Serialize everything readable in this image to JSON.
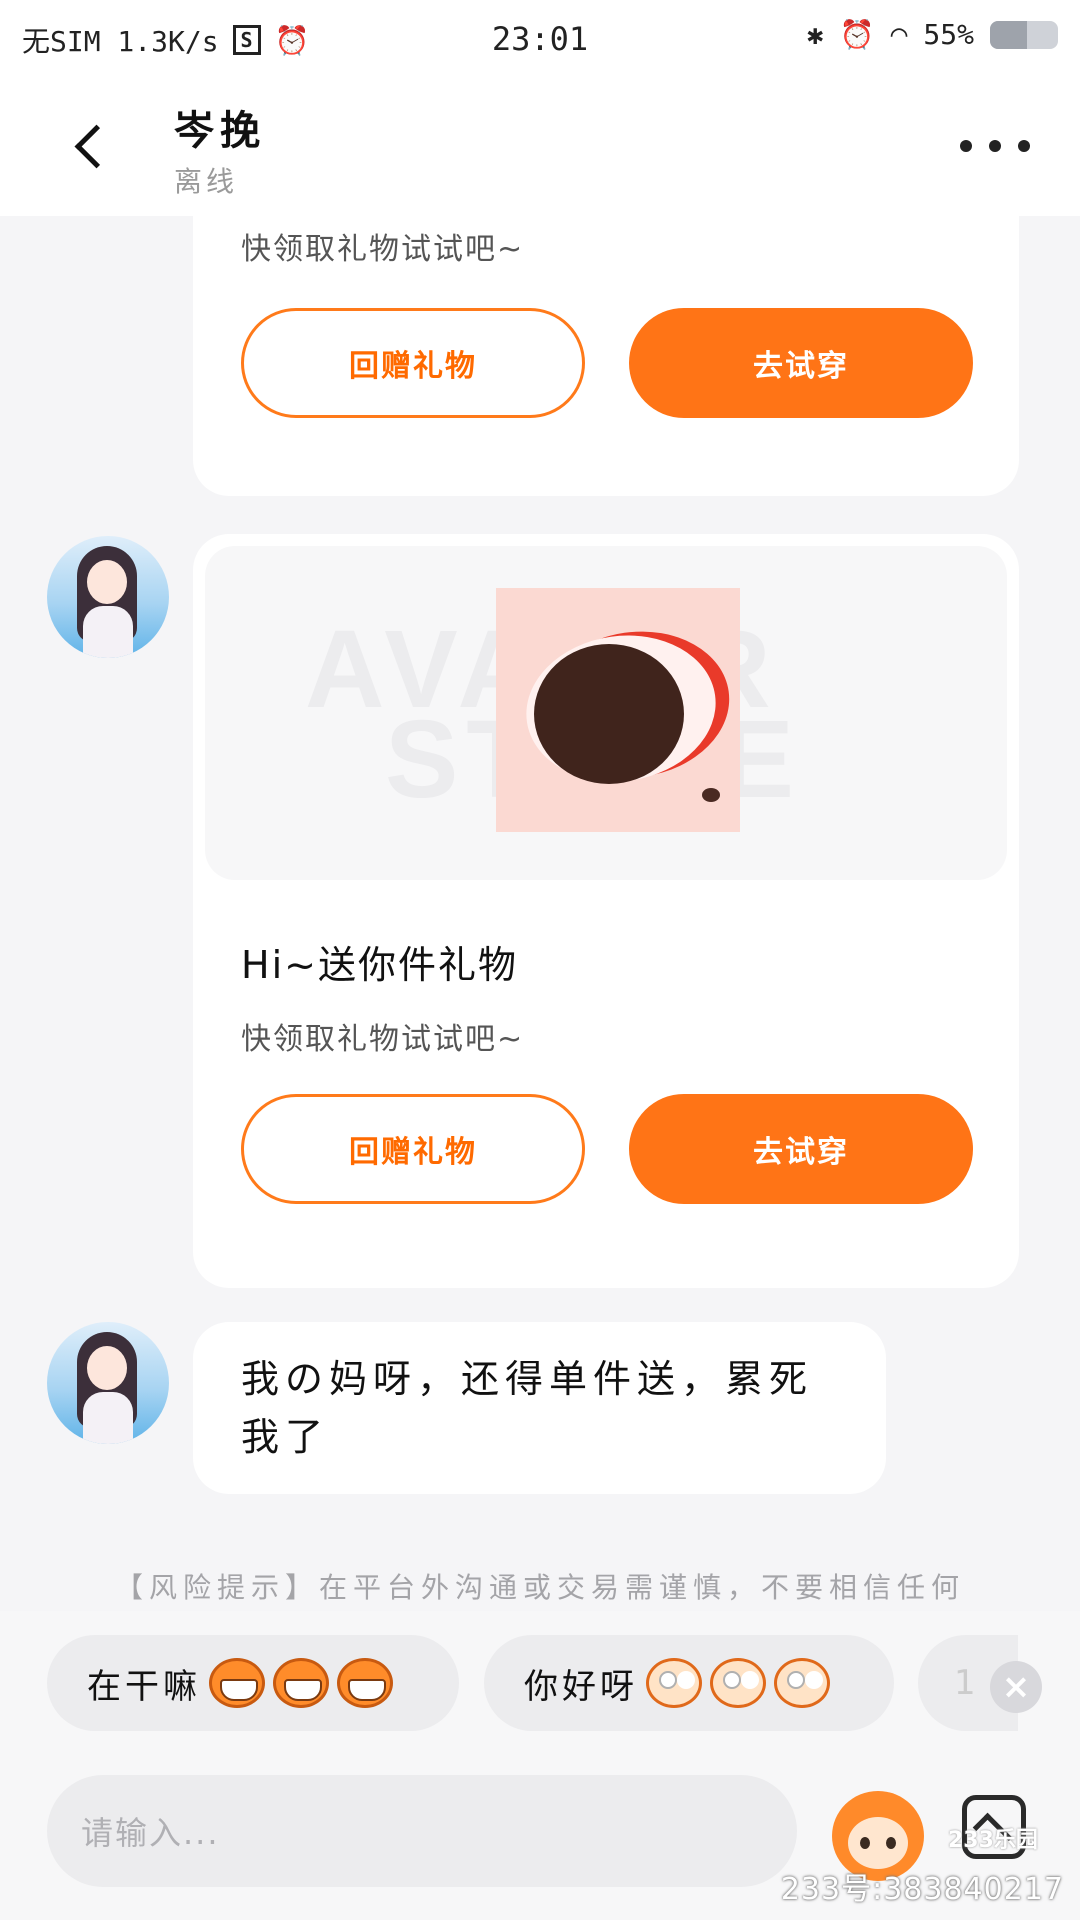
{
  "status_bar": {
    "left": "无SIM 1.3K/s",
    "sim_icon": "S",
    "time": "23:01",
    "battery": "55%",
    "battery_level": 0.55
  },
  "header": {
    "title": "岑挽",
    "subtitle": "离线"
  },
  "messages": [
    {
      "type": "gift",
      "subtitle": "快领取礼物试试吧~",
      "btn_outline": "回赠礼物",
      "btn_solid": "去试穿"
    },
    {
      "type": "gift",
      "preview_watermark_1": "AVATAR",
      "preview_watermark_2": "STORE",
      "title": "Hi~送你件礼物",
      "subtitle": "快领取礼物试试吧~",
      "btn_outline": "回赠礼物",
      "btn_solid": "去试穿"
    },
    {
      "type": "text",
      "text": "我の妈呀，还得单件送，累死我了"
    }
  ],
  "risk_tip": "【风险提示】在平台外沟通或交易需谨慎，不要相信任何",
  "quick_replies": [
    {
      "label": "在干嘛",
      "emoji": "grin-mascot-icon"
    },
    {
      "label": "你好呀",
      "emoji": "blush-mascot-icon"
    },
    {
      "label": "1"
    }
  ],
  "input": {
    "placeholder": "请输入..."
  },
  "watermark": {
    "logo": "233乐园",
    "id": "233号:383840217"
  },
  "colors": {
    "accent": "#ff7416",
    "background": "#f5f5f7"
  }
}
